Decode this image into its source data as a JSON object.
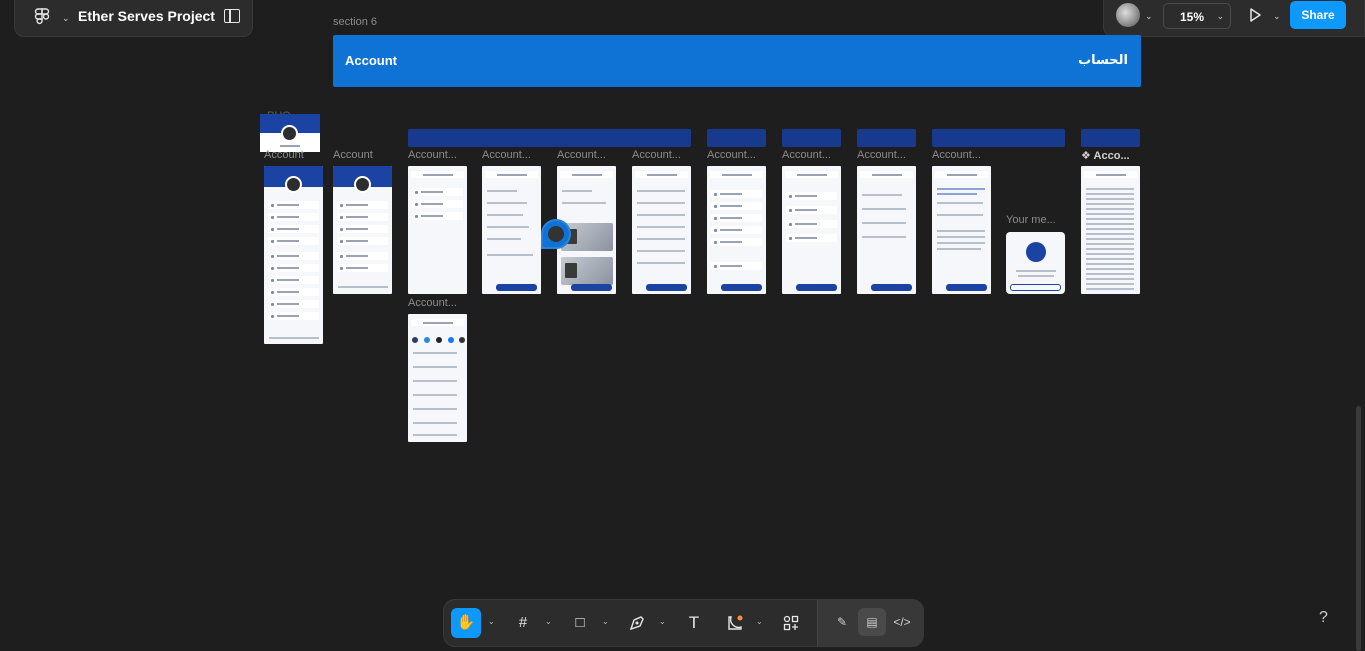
{
  "app": {
    "project_title": "Ether Serves Project"
  },
  "toolbar_right": {
    "zoom": "15%",
    "share_label": "Share"
  },
  "canvas": {
    "section_label": "section 6",
    "banner_en": "Account",
    "banner_ar": "الحساب",
    "photo_label": "PHO...",
    "frame_labels": [
      "Account",
      "Account",
      "Account...",
      "Account...",
      "Account...",
      "Account...",
      "Account...",
      "Account...",
      "Account...",
      "Account...",
      "❖ Acco...",
      "Your me...",
      "Account..."
    ]
  },
  "bottom_toolbar": {
    "tools": [
      "hand-tool",
      "frame-tool",
      "rectangle-tool",
      "pen-tool",
      "text-tool",
      "shape-tool",
      "actions-tool"
    ],
    "active_tool": "hand-tool",
    "help_label": "?"
  }
}
